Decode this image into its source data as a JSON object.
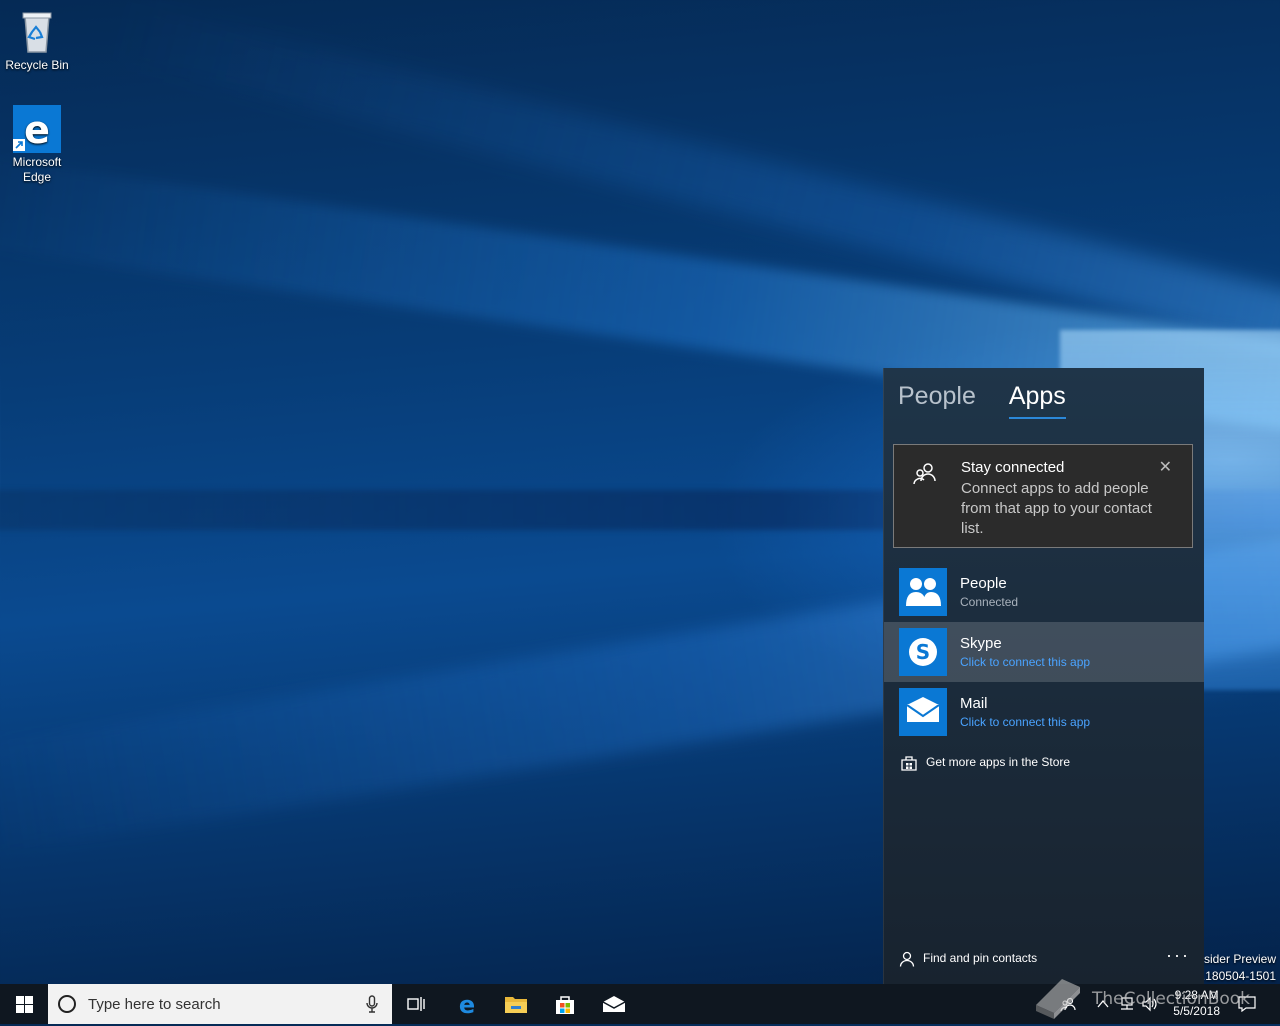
{
  "desktop": {
    "icons": [
      {
        "label": "Recycle Bin",
        "icon": "recycle-bin-icon"
      },
      {
        "label": "Microsoft\nEdge",
        "icon": "edge-icon"
      }
    ]
  },
  "people_flyout": {
    "tabs": [
      {
        "label": "People",
        "active": false
      },
      {
        "label": "Apps",
        "active": true
      }
    ],
    "notice": {
      "title": "Stay connected",
      "body": "Connect apps to add people from that app to your contact list.",
      "close": "✕"
    },
    "apps": [
      {
        "name": "People",
        "status": "Connected",
        "icon": "people-app-icon"
      },
      {
        "name": "Skype",
        "status": "Click to connect this app",
        "icon": "skype-icon"
      },
      {
        "name": "Mail",
        "status": "Click to connect this app",
        "icon": "mail-icon"
      }
    ],
    "store_link": "Get more apps in the Store",
    "find_pin": "Find and pin contacts",
    "more": "···"
  },
  "watermark": {
    "line1": "nsider Preview",
    "line2": "e.180504-1501"
  },
  "taskbar": {
    "search_placeholder": "Type here to search",
    "clock_time": "9:28 AM",
    "clock_date": "5/5/2018"
  },
  "site_watermark": "TheCollectionBook",
  "colors": {
    "accent": "#2b88d8",
    "link_blue": "#4aa3ff",
    "app_tile": "#0a78d4"
  }
}
